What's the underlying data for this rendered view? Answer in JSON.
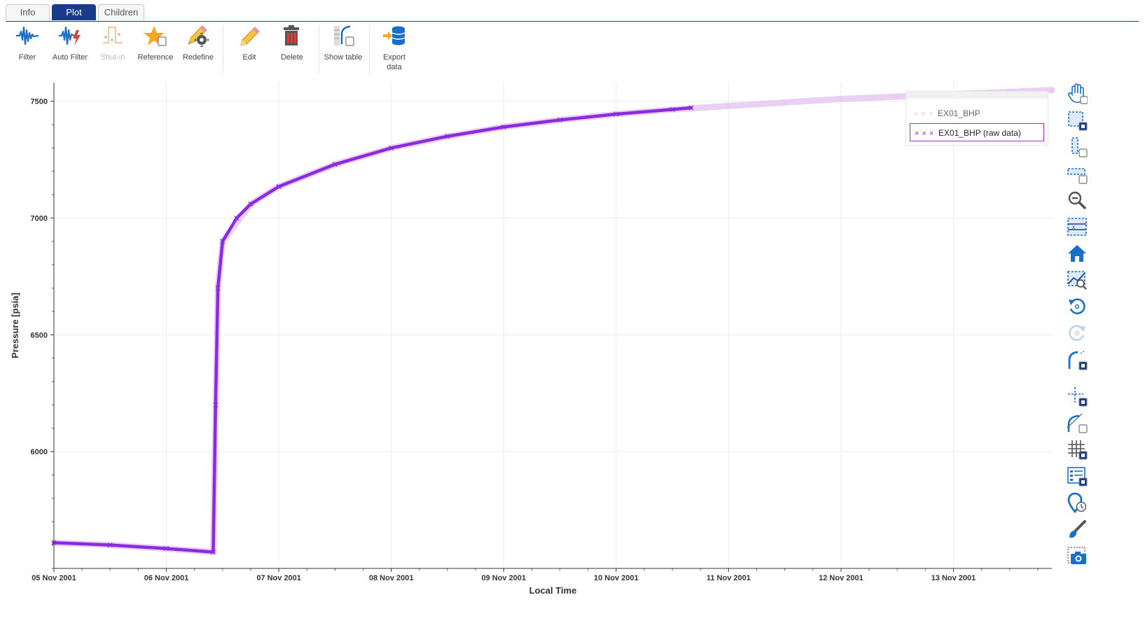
{
  "tabs": [
    {
      "label": "Info",
      "active": false
    },
    {
      "label": "Plot",
      "active": true
    },
    {
      "label": "Children",
      "active": false
    }
  ],
  "toolbar": [
    {
      "label": "Filter",
      "icon": "waveform-icon",
      "disabled": false
    },
    {
      "label": "Auto Filter",
      "icon": "auto-filter-icon",
      "disabled": false
    },
    {
      "label": "Shut-in",
      "icon": "shut-in-icon",
      "disabled": true
    },
    {
      "label": "Reference",
      "icon": "star-icon",
      "disabled": false
    },
    {
      "label": "Redefine",
      "icon": "pencil-gear-icon",
      "disabled": false
    },
    {
      "label": "Edit",
      "icon": "pencil-icon",
      "disabled": false
    },
    {
      "label": "Delete",
      "icon": "trash-icon",
      "disabled": false
    },
    {
      "label": "Show table",
      "icon": "table-icon",
      "disabled": false
    },
    {
      "label": "Export data",
      "icon": "database-export-icon",
      "disabled": false
    }
  ],
  "legend": [
    {
      "label": "EX01_BHP",
      "color": "#e6c8f0",
      "selected": false
    },
    {
      "label": "EX01_BHP (raw data)",
      "color": "#8a2be2",
      "selected": true
    }
  ],
  "right_tools": [
    "pan-icon",
    "box-zoom-icon",
    "x-zoom-icon",
    "y-zoom-icon",
    "zoom-out-icon",
    "zoom-select-icon",
    "home-icon",
    "zoom-fit-icon",
    "undo-icon",
    "redo-icon",
    "curve-select-icon",
    "crosshair-icon",
    "tangent-icon",
    "grid-icon",
    "legend-icon",
    "pin-clock-icon",
    "brush-icon",
    "camera-icon"
  ],
  "chart_data": {
    "type": "scatter",
    "xlabel": "Local Time",
    "ylabel": "Pressure [psia]",
    "x_ticks": [
      "05 Nov 2001",
      "06 Nov 2001",
      "07 Nov 2001",
      "08 Nov 2001",
      "09 Nov 2001",
      "10 Nov 2001",
      "11 Nov 2001",
      "12 Nov 2001",
      "13 Nov 2001"
    ],
    "y_ticks": [
      6000,
      6500,
      7000,
      7500
    ],
    "xlim": [
      "2001-11-05",
      "2001-11-13 21:00"
    ],
    "ylim": [
      5500,
      7580
    ],
    "grid": true,
    "legend_position": "top-right",
    "series": [
      {
        "name": "EX01_BHP",
        "color": "#e6c8f0",
        "x": [
          "2001-11-05 00:00",
          "2001-11-05 12:00",
          "2001-11-06 00:00",
          "2001-11-06 10:00",
          "2001-11-06 11:00",
          "2001-11-06 12:00",
          "2001-11-06 18:00",
          "2001-11-07 00:00",
          "2001-11-07 12:00",
          "2001-11-08 00:00",
          "2001-11-08 12:00",
          "2001-11-09 00:00",
          "2001-11-09 12:00",
          "2001-11-10 00:00",
          "2001-11-10 12:00",
          "2001-11-11 00:00",
          "2001-11-11 12:00",
          "2001-11-12 00:00",
          "2001-11-12 12:00",
          "2001-11-13 00:00",
          "2001-11-13 12:00",
          "2001-11-13 21:00"
        ],
        "y": [
          5610,
          5600,
          5585,
          5570,
          6700,
          6900,
          7060,
          7135,
          7230,
          7300,
          7350,
          7390,
          7420,
          7445,
          7465,
          7480,
          7495,
          7510,
          7520,
          7530,
          7540,
          7548
        ]
      },
      {
        "name": "EX01_BHP (raw data)",
        "color": "#8a2be2",
        "x": [
          "2001-11-05 00:00",
          "2001-11-05 12:00",
          "2001-11-06 00:00",
          "2001-11-06 10:00",
          "2001-11-06 10:30",
          "2001-11-06 11:00",
          "2001-11-06 12:00",
          "2001-11-06 15:00",
          "2001-11-06 18:00",
          "2001-11-07 00:00",
          "2001-11-07 12:00",
          "2001-11-08 00:00",
          "2001-11-08 12:00",
          "2001-11-09 00:00",
          "2001-11-09 12:00",
          "2001-11-10 00:00",
          "2001-11-10 12:00",
          "2001-11-10 16:00"
        ],
        "y": [
          5610,
          5600,
          5585,
          5570,
          6200,
          6700,
          6900,
          7000,
          7060,
          7135,
          7230,
          7300,
          7350,
          7390,
          7420,
          7445,
          7465,
          7472
        ]
      }
    ]
  }
}
